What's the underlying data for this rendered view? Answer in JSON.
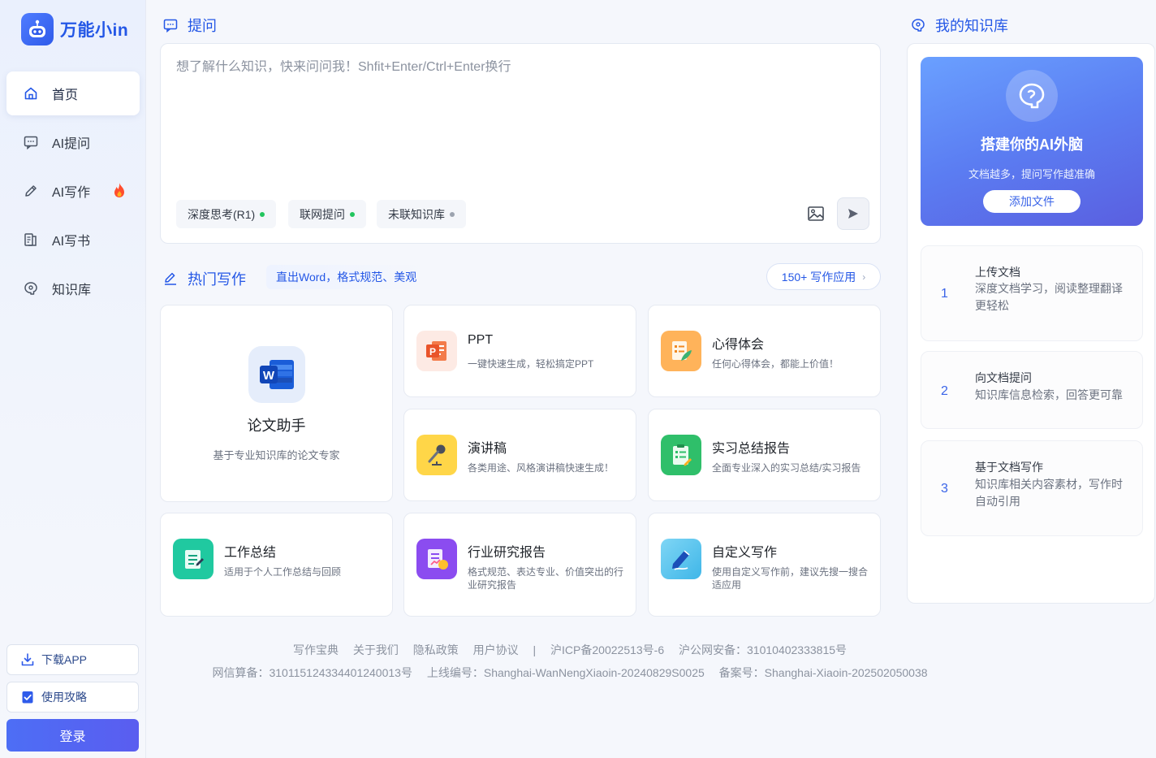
{
  "app": {
    "name": "万能小in"
  },
  "sidebar": {
    "items": [
      {
        "label": "首页",
        "icon": "home-icon",
        "active": true
      },
      {
        "label": "AI提问",
        "icon": "chat-icon"
      },
      {
        "label": "AI写作",
        "icon": "pen-icon",
        "badge": "fire-icon"
      },
      {
        "label": "AI写书",
        "icon": "book-icon"
      },
      {
        "label": "知识库",
        "icon": "brain-icon"
      }
    ],
    "download": "下载APP",
    "guide": "使用攻略",
    "login": "登录"
  },
  "ask": {
    "title": "提问",
    "placeholder": "想了解什么知识，快来问问我！Shfit+Enter/Ctrl+Enter换行",
    "chips": [
      {
        "label": "深度思考(R1)",
        "dot_color": "#22c55e"
      },
      {
        "label": "联网提问",
        "dot_color": "#22c55e"
      },
      {
        "label": "未联知识库",
        "dot_color": "#9ca3af"
      }
    ]
  },
  "hot": {
    "title": "热门写作",
    "subtitle": "直出Word，格式规范、美观",
    "more": "150+ 写作应用",
    "featured": {
      "title": "论文助手",
      "desc": "基于专业知识库的论文专家"
    },
    "cards": [
      {
        "title": "PPT",
        "desc": "一键快速生成，轻松搞定PPT",
        "icon": "ppt-icon"
      },
      {
        "title": "心得体会",
        "desc": "任何心得体会，都能上价值！",
        "icon": "notes-icon"
      },
      {
        "title": "演讲稿",
        "desc": "各类用途、风格演讲稿快速生成！",
        "icon": "microphone-icon"
      },
      {
        "title": "实习总结报告",
        "desc": "全面专业深入的实习总结/实习报告",
        "icon": "report-icon"
      },
      {
        "title": "工作总结",
        "desc": "适用于个人工作总结与回顾",
        "icon": "summary-icon"
      },
      {
        "title": "行业研究报告",
        "desc": "格式规范、表达专业、价值突出的行业研究报告",
        "icon": "research-icon"
      },
      {
        "title": "自定义写作",
        "desc": "使用自定义写作前，建议先搜一搜合适应用",
        "icon": "custom-write-icon"
      }
    ]
  },
  "kb": {
    "title": "我的知识库",
    "hero_title": "搭建你的AI外脑",
    "hero_sub": "文档越多，提问写作越准确",
    "hero_button": "添加文件",
    "steps": [
      {
        "num": "1",
        "title": "上传文档",
        "desc": "深度文档学习，阅读整理翻译更轻松"
      },
      {
        "num": "2",
        "title": "向文档提问",
        "desc": "知识库信息检索，回答更可靠"
      },
      {
        "num": "3",
        "title": "基于文档写作",
        "desc": "知识库相关内容素材，写作时自动引用"
      }
    ]
  },
  "footer": {
    "links": [
      "写作宝典",
      "关于我们",
      "隐私政策",
      "用户协议"
    ],
    "sep": "|",
    "icp": "沪ICP备20022513号-6",
    "police": "沪公网安备：31010402333815号",
    "net": "网信算备：310115124334401240013号",
    "online": "上线编号：Shanghai-WanNengXiaoin-20240829S0025",
    "filing": "备案号：Shanghai-Xiaoin-202502050038"
  }
}
